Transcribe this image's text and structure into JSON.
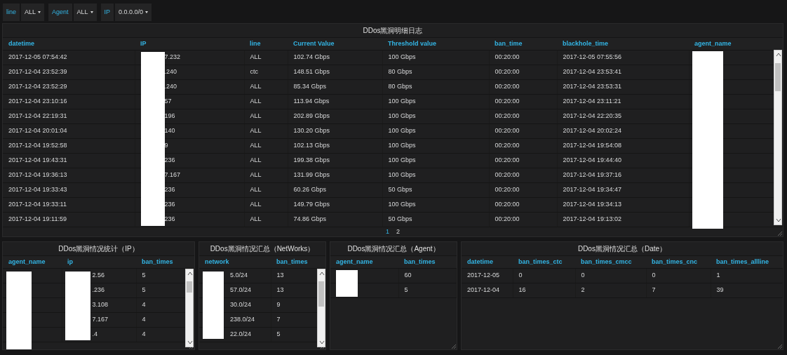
{
  "variables": [
    {
      "label": "line",
      "value": "ALL"
    },
    {
      "label": "Agent",
      "value": "ALL"
    },
    {
      "label": "IP",
      "value": "0.0.0.0/0"
    }
  ],
  "panels": [
    {
      "title": "DDos黑洞明细日志",
      "columns": [
        "datetime",
        "IP",
        "line",
        "Current Value",
        "Threshold value",
        "ban_time",
        "blackhole_time",
        "agent_name"
      ],
      "rows": [
        [
          "2017-12-05 07:54:42",
          "7.232",
          "ALL",
          "102.74 Gbps",
          "100 Gbps",
          "00:20:00",
          "2017-12-05 07:55:56",
          null
        ],
        [
          "2017-12-04 23:52:39",
          ".240",
          "ctc",
          "148.51 Gbps",
          "80 Gbps",
          "00:20:00",
          "2017-12-04 23:53:41",
          null
        ],
        [
          "2017-12-04 23:52:29",
          ".240",
          "ALL",
          "85.34 Gbps",
          "80 Gbps",
          "00:20:00",
          "2017-12-04 23:53:31",
          null
        ],
        [
          "2017-12-04 23:10:16",
          "57",
          "ALL",
          "113.94 Gbps",
          "100 Gbps",
          "00:20:00",
          "2017-12-04 23:11:21",
          null
        ],
        [
          "2017-12-04 22:19:31",
          "196",
          "ALL",
          "202.89 Gbps",
          "100 Gbps",
          "00:20:00",
          "2017-12-04 22:20:35",
          null
        ],
        [
          "2017-12-04 20:01:04",
          "140",
          "ALL",
          "130.20 Gbps",
          "100 Gbps",
          "00:20:00",
          "2017-12-04 20:02:24",
          null
        ],
        [
          "2017-12-04 19:52:58",
          "9",
          "ALL",
          "102.13 Gbps",
          "100 Gbps",
          "00:20:00",
          "2017-12-04 19:54:08",
          null
        ],
        [
          "2017-12-04 19:43:31",
          "236",
          "ALL",
          "199.38 Gbps",
          "100 Gbps",
          "00:20:00",
          "2017-12-04 19:44:40",
          null
        ],
        [
          "2017-12-04 19:36:13",
          "7.167",
          "ALL",
          "131.99 Gbps",
          "100 Gbps",
          "00:20:00",
          "2017-12-04 19:37:16",
          null
        ],
        [
          "2017-12-04 19:33:43",
          "236",
          "ALL",
          "60.26 Gbps",
          "50 Gbps",
          "00:20:00",
          "2017-12-04 19:34:47",
          null
        ],
        [
          "2017-12-04 19:33:11",
          "236",
          "ALL",
          "149.79 Gbps",
          "100 Gbps",
          "00:20:00",
          "2017-12-04 19:34:13",
          null
        ],
        [
          "2017-12-04 19:11:59",
          "236",
          "ALL",
          "74.86 Gbps",
          "50 Gbps",
          "00:20:00",
          "2017-12-04 19:13:02",
          null
        ]
      ],
      "pages": [
        {
          "label": "1",
          "selected": true
        },
        {
          "label": "2",
          "selected": false
        }
      ]
    },
    {
      "title": "DDos黑洞情况统计（IP）",
      "columns": [
        "agent_name",
        "ip",
        "ban_times"
      ],
      "rows": [
        [
          null,
          "2.56",
          "5"
        ],
        [
          null,
          ".236",
          "5"
        ],
        [
          null,
          "3.108",
          "4"
        ],
        [
          null,
          "7.167",
          "4"
        ],
        [
          null,
          ".4",
          "4"
        ]
      ]
    },
    {
      "title": "DDos黑洞情况汇总（NetWorks）",
      "columns": [
        "network",
        "ban_times"
      ],
      "rows": [
        [
          "5.0/24",
          "13"
        ],
        [
          "57.0/24",
          "13"
        ],
        [
          "30.0/24",
          "9"
        ],
        [
          "238.0/24",
          "7"
        ],
        [
          "22.0/24",
          "5"
        ]
      ]
    },
    {
      "title": "DDos黑洞情况汇总（Agent）",
      "columns": [
        "agent_name",
        "ban_times"
      ],
      "rows": [
        [
          null,
          "60"
        ],
        [
          null,
          "5"
        ]
      ]
    },
    {
      "title": "DDos黑洞情况汇总（Date）",
      "columns": [
        "datetime",
        "ban_times_ctc",
        "ban_times_cmcc",
        "ban_times_cnc",
        "ban_times_allline"
      ],
      "rows": [
        [
          "2017-12-05",
          "0",
          "0",
          "0",
          "1"
        ],
        [
          "2017-12-04",
          "16",
          "2",
          "7",
          "39"
        ]
      ]
    }
  ]
}
